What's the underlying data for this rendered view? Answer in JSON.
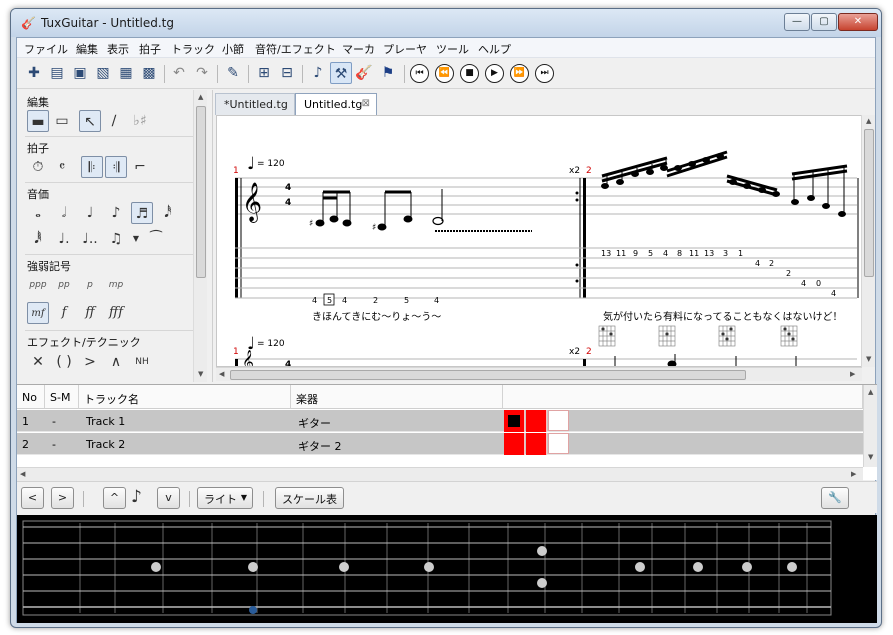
{
  "window": {
    "title": "TuxGuitar - Untitled.tg",
    "minimize": "—",
    "maximize": "▢",
    "close": "✕"
  },
  "menu": [
    "ファイル",
    "編集",
    "表示",
    "拍子",
    "トラック",
    "小節",
    "音符/エフェクト",
    "マーカ",
    "プレーヤ",
    "ツール",
    "ヘルプ"
  ],
  "toolbar": {
    "icons": [
      "new-file-icon",
      "open-file-icon",
      "save-icon",
      "save-as-icon",
      "print-icon",
      "print-preview-icon",
      "undo-icon",
      "redo-icon",
      "edit-mode-icon",
      "measure-insert-icon",
      "measure-remove-icon",
      "note-icon",
      "edit-tool-icon",
      "guitar-icon",
      "marker-flag-icon"
    ],
    "transport": [
      "first-icon",
      "previous-icon",
      "stop-icon",
      "play-icon",
      "next-icon",
      "last-icon"
    ]
  },
  "left_panel": {
    "sections": [
      "編集",
      "拍子",
      "音価",
      "強弱記号",
      "エフェクト/テクニック"
    ],
    "dynamics": [
      "ppp",
      "pp",
      "p",
      "mp",
      "mf",
      "f",
      "ff",
      "fff"
    ]
  },
  "tabs": [
    {
      "label": "*Untitled.tg",
      "selected": false
    },
    {
      "label": "Untitled.tg",
      "selected": true,
      "close": "⊠"
    }
  ],
  "score": {
    "tempo": "= 120",
    "time_sig_top": "4",
    "time_sig_bottom": "4",
    "measure_1": "1",
    "measure_2": "2",
    "repeat": "x2",
    "tab_numbers_1": [
      "4",
      "5",
      "4",
      "2",
      "5",
      "4"
    ],
    "tab_numbers_2": [
      "13",
      "11",
      "9",
      "5",
      "4",
      "8",
      "11",
      "13",
      "3",
      "1",
      "4",
      "2",
      "2",
      "4",
      "0",
      "4"
    ],
    "lyrics_1": "きほんてきにむ～りょ～う～",
    "lyrics_2": "気が付いたら有料になってることもなくはないけど！",
    "system2_tempo": "= 120",
    "system2_measure_1": "1",
    "system2_measure_2": "2",
    "system2_repeat": "x2",
    "system2_time_sig": "4"
  },
  "track_table": {
    "headers": [
      "No",
      "S-M",
      "トラック名",
      "楽器"
    ],
    "rows": [
      {
        "no": "1",
        "sm": "-",
        "name": "Track 1",
        "instrument": "ギター"
      },
      {
        "no": "2",
        "sm": "-",
        "name": "Track 2",
        "instrument": "ギター 2"
      }
    ]
  },
  "fretboard_tools": {
    "prev": "<",
    "next": ">",
    "up": "^",
    "down": "v",
    "scheme": "ライト",
    "scale": "スケール表"
  },
  "colors": {
    "track_cell": "#ff0000",
    "selected_track": "#c6c6c6",
    "fretboard_bg": "#000000",
    "fret_marker": "#cccccc",
    "position_dot": "#2a5c9a"
  }
}
